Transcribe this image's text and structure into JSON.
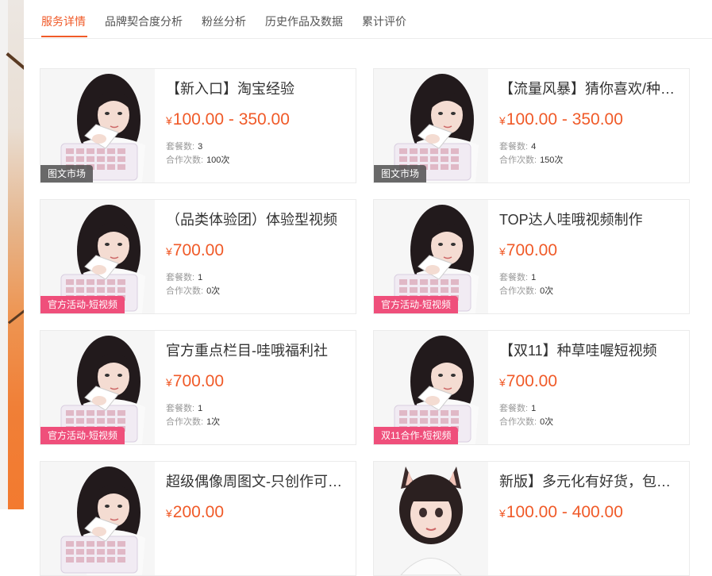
{
  "tabs": [
    "服务详情",
    "品牌契合度分析",
    "粉丝分析",
    "历史作品及数据",
    "累计评价"
  ],
  "meta_labels": {
    "packages": "套餐数:",
    "orders": "合作次数:"
  },
  "currency": "¥",
  "colors": {
    "accent": "#f05a28",
    "badge_pink": "#ef4f7b",
    "badge_gray": "#505050"
  },
  "cards": [
    {
      "title": "【新入口】淘宝经验",
      "price": "100.00 - 350.00",
      "packages": "3",
      "orders": "100次",
      "badge": "图文市场",
      "badge_style": "gray",
      "avatar": "girl-with-keyboard"
    },
    {
      "title": "【流量风暴】猜你喜欢/种草...",
      "price": "100.00 - 350.00",
      "packages": "4",
      "orders": "150次",
      "badge": "图文市场",
      "badge_style": "gray",
      "avatar": "girl-with-keyboard"
    },
    {
      "title": "（品类体验团）体验型视频",
      "price": "700.00",
      "packages": "1",
      "orders": "0次",
      "badge": "官方活动-短视频",
      "badge_style": "pink",
      "avatar": "girl-with-keyboard"
    },
    {
      "title": "TOP达人哇哦视频制作",
      "price": "700.00",
      "packages": "1",
      "orders": "0次",
      "badge": "官方活动-短视频",
      "badge_style": "pink",
      "avatar": "girl-with-keyboard"
    },
    {
      "title": "官方重点栏目-哇哦福利社",
      "price": "700.00",
      "packages": "1",
      "orders": "1次",
      "badge": "官方活动-短视频",
      "badge_style": "pink",
      "avatar": "girl-with-keyboard"
    },
    {
      "title": "【双11】种草哇喔短视频",
      "price": "700.00",
      "packages": "1",
      "orders": "0次",
      "badge": "双11合作-短视频",
      "badge_style": "pink",
      "avatar": "girl-with-keyboard"
    },
    {
      "title": "超级偶像周图文-只创作可读...",
      "price": "200.00",
      "packages": "",
      "orders": "",
      "badge": "",
      "badge_style": "",
      "avatar": "girl-with-keyboard"
    },
    {
      "title": "新版】多元化有好货，包通过",
      "price": "100.00 - 400.00",
      "packages": "",
      "orders": "",
      "badge": "",
      "badge_style": "",
      "avatar": "cartoon-cat-ear-girl"
    }
  ]
}
